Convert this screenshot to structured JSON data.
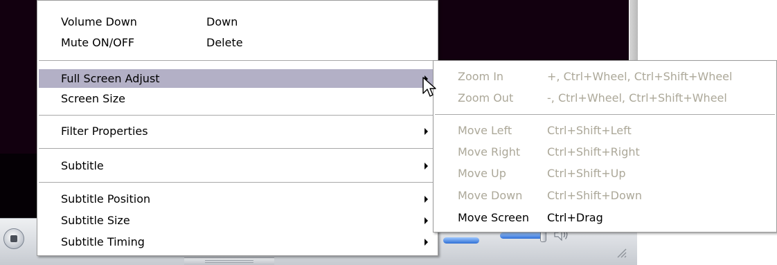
{
  "main_menu": {
    "items": [
      {
        "label": "Volume Down",
        "shortcut": "Down"
      },
      {
        "label": "Mute ON/OFF",
        "shortcut": "Delete"
      },
      {
        "label": "Full Screen Adjust",
        "submenu": true,
        "highlighted": true
      },
      {
        "label": "Screen Size"
      },
      {
        "label": "Filter Properties",
        "submenu": true
      },
      {
        "label": "Subtitle",
        "submenu": true
      },
      {
        "label": "Subtitle Position",
        "submenu": true
      },
      {
        "label": "Subtitle Size",
        "submenu": true
      },
      {
        "label": "Subtitle Timing",
        "submenu": true
      }
    ]
  },
  "submenu": {
    "parent": "Full Screen Adjust",
    "items": [
      {
        "label": "Zoom In",
        "shortcut": "+, Ctrl+Wheel, Ctrl+Shift+Wheel",
        "enabled": false
      },
      {
        "label": "Zoom Out",
        "shortcut": "-, Ctrl+Wheel, Ctrl+Shift+Wheel",
        "enabled": false
      },
      {
        "label": "Move Left",
        "shortcut": "Ctrl+Shift+Left",
        "enabled": false
      },
      {
        "label": "Move Right",
        "shortcut": "Ctrl+Shift+Right",
        "enabled": false
      },
      {
        "label": "Move Up",
        "shortcut": "Ctrl+Shift+Up",
        "enabled": false
      },
      {
        "label": "Move Down",
        "shortcut": "Ctrl+Shift+Down",
        "enabled": false
      },
      {
        "label": "Move Screen",
        "shortcut": "Ctrl+Drag",
        "enabled": true
      }
    ]
  },
  "colors": {
    "highlight": "#b3b0c6",
    "disabled_text": "#aca899",
    "video_background": "#12000f",
    "seek_bar": "#2f6fd6"
  },
  "icons": {
    "cursor": "mouse-pointer-icon",
    "stop": "stop-icon",
    "speaker": "speaker-icon",
    "resize": "resize-grip-icon"
  }
}
